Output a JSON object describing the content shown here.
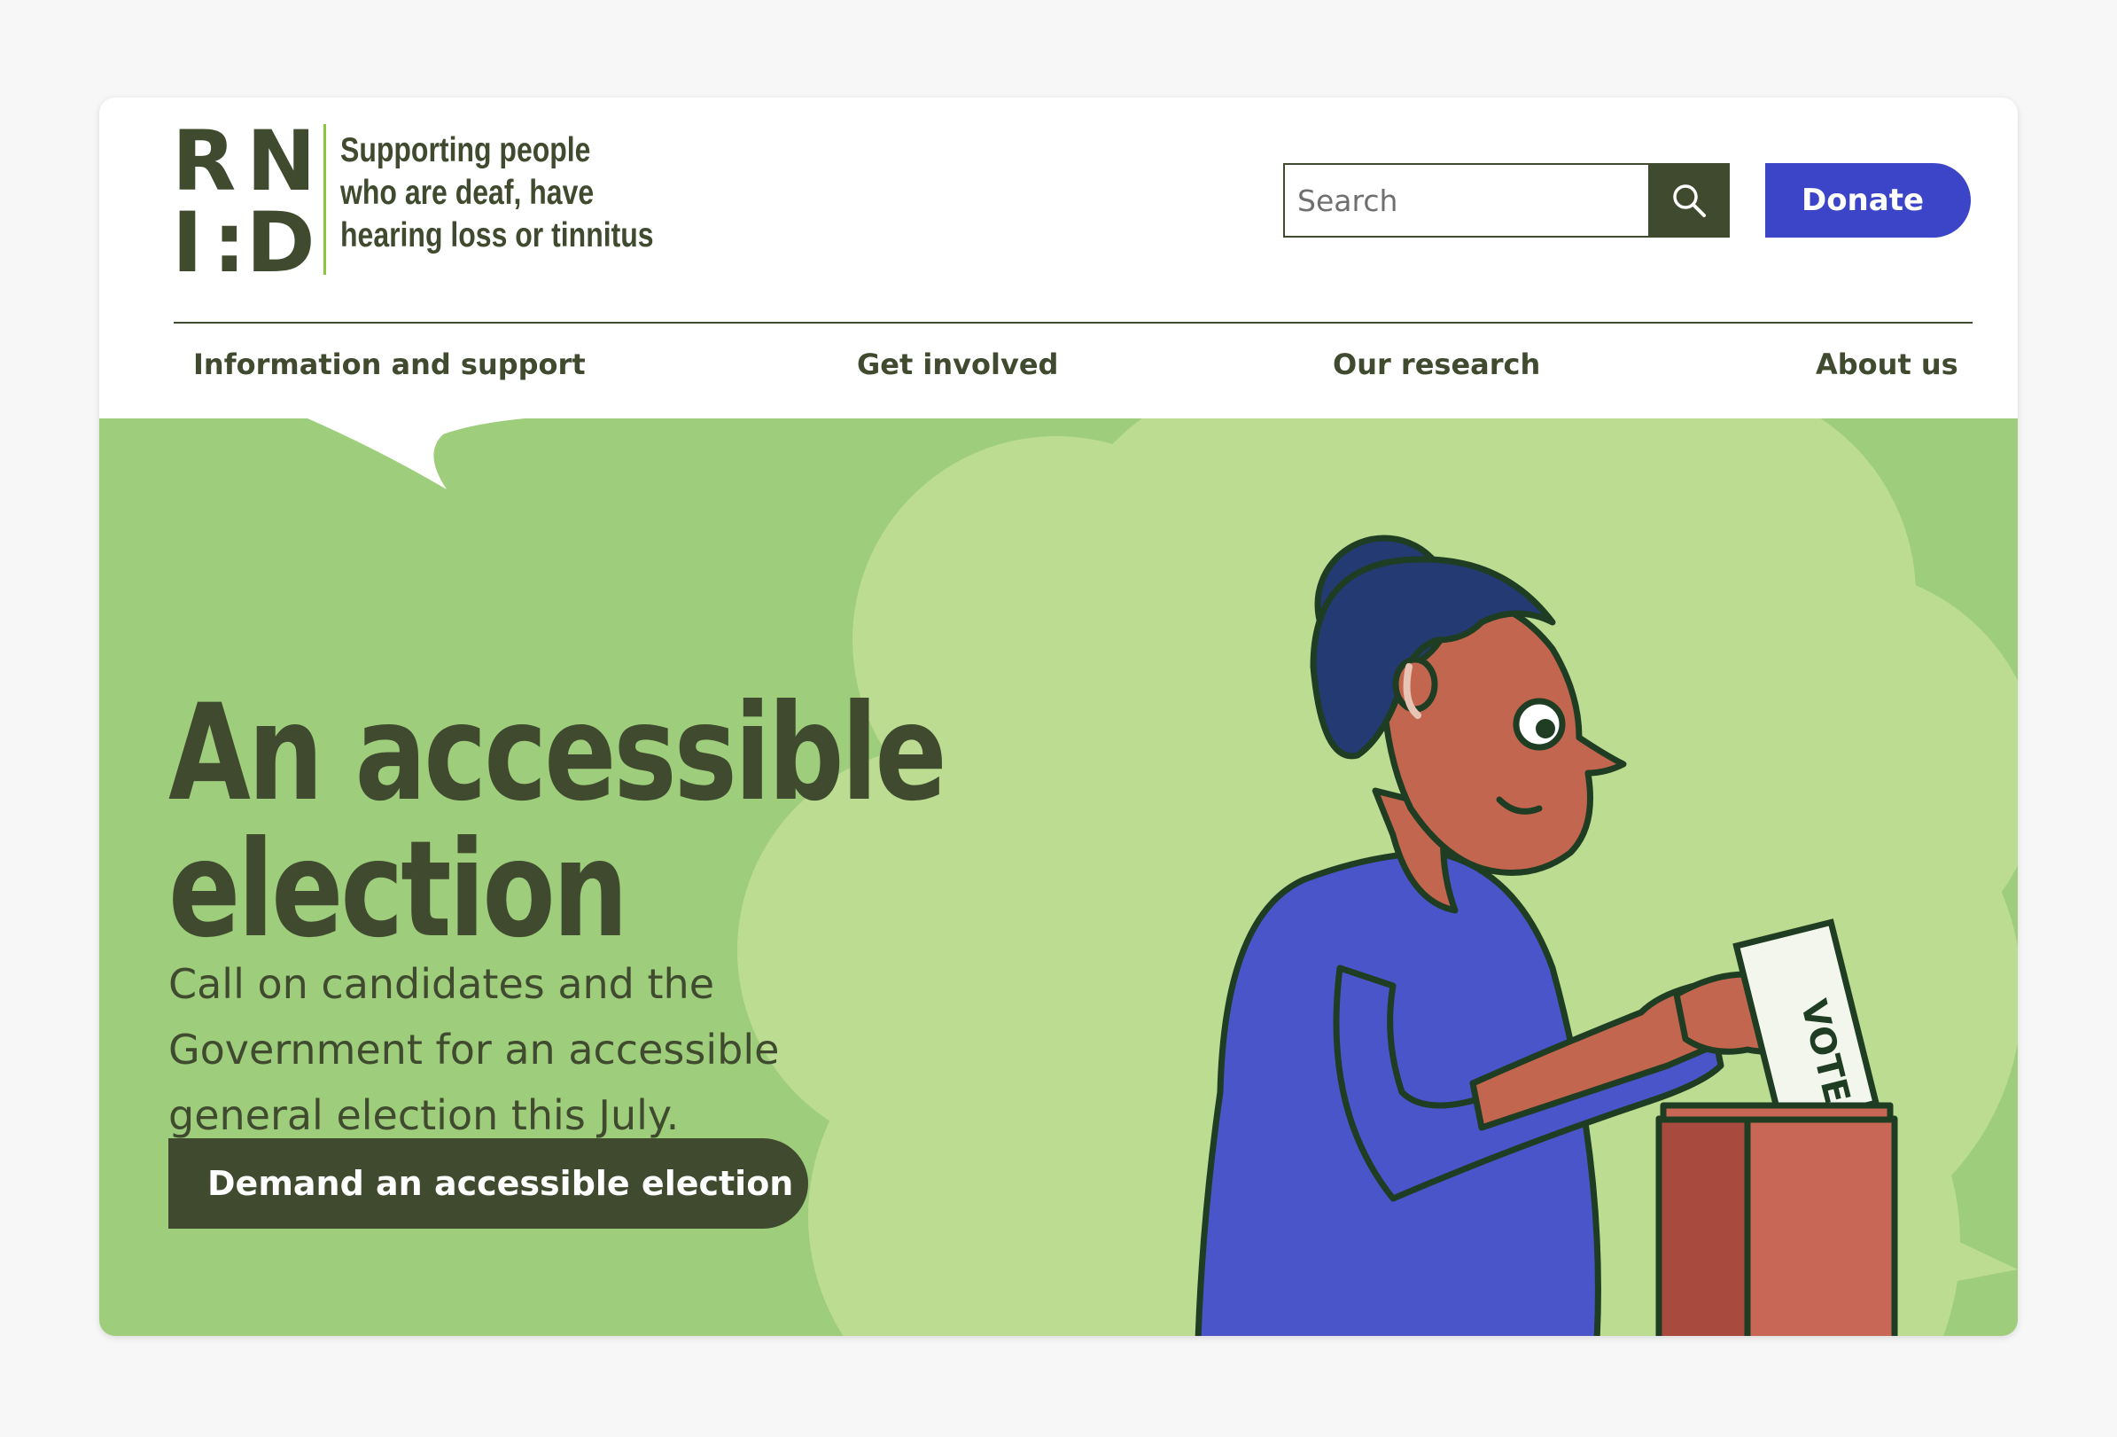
{
  "logo": {
    "letters": [
      "R",
      "N",
      "I",
      ":D"
    ],
    "tagline": [
      "Supporting people",
      "who are deaf, have",
      "hearing loss or tinnitus"
    ]
  },
  "search": {
    "placeholder": "Search",
    "icon": "search-icon"
  },
  "donate": {
    "label": "Donate"
  },
  "nav": {
    "items": [
      {
        "label": "Information and support"
      },
      {
        "label": "Get involved"
      },
      {
        "label": "Our research"
      },
      {
        "label": "About us"
      }
    ]
  },
  "hero": {
    "headline": [
      "An accessible",
      "election"
    ],
    "lead": "Call on candidates and the Government for an accessible general election this July.",
    "cta": "Demand an accessible election",
    "ballot_text": "VOTE"
  },
  "colors": {
    "brand_dark": "#3f4a2f",
    "brand_green": "#8cc63f",
    "hero_bg": "#9ecd7c",
    "hero_cloud": "#bcdc92",
    "donate_blue": "#3c45c8"
  }
}
